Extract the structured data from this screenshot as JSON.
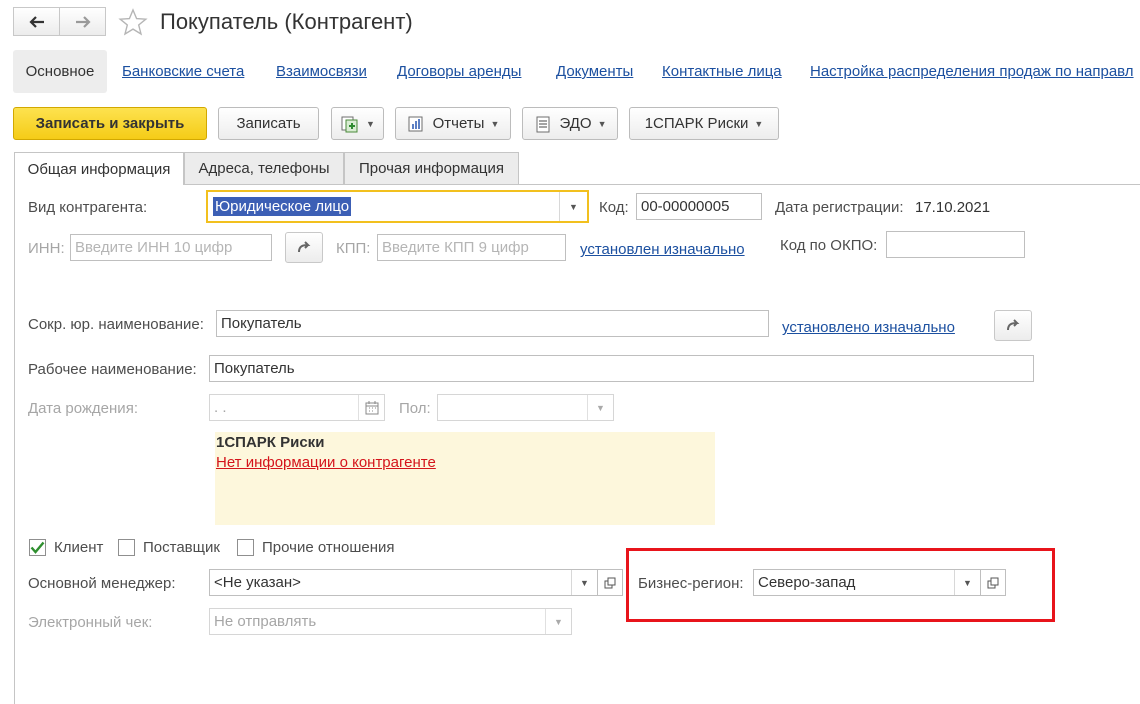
{
  "window": {
    "title": "Покупатель (Контрагент)"
  },
  "section_nav": [
    {
      "label": "Основное",
      "active": true
    },
    {
      "label": "Банковские счета"
    },
    {
      "label": "Взаимосвязи"
    },
    {
      "label": "Договоры аренды"
    },
    {
      "label": "Документы"
    },
    {
      "label": "Контактные лица"
    },
    {
      "label": "Настройка распределения продаж по направл"
    }
  ],
  "toolbar": {
    "save_close": "Записать и закрыть",
    "save": "Записать",
    "reports": "Отчеты",
    "edo": "ЭДО",
    "spark": "1СПАРК Риски"
  },
  "tabs": [
    {
      "label": "Общая информация",
      "active": true
    },
    {
      "label": "Адреса, телефоны"
    },
    {
      "label": "Прочая информация"
    }
  ],
  "form": {
    "kind_label": "Вид контрагента:",
    "kind_value": "Юридическое лицо",
    "code_label": "Код:",
    "code_value": "00-00000005",
    "reg_date_label": "Дата регистрации:",
    "reg_date_value": "17.10.2021",
    "inn_label": "ИНН:",
    "inn_placeholder": "Введите ИНН 10 цифр",
    "kpp_label": "КПП:",
    "kpp_placeholder": "Введите КПП 9 цифр",
    "kpp_link": "установлен изначально",
    "okpo_label": "Код по ОКПО:",
    "okpo_value": "",
    "short_name_label": "Сокр. юр. наименование:",
    "short_name_value": "Покупатель",
    "short_name_link": "установлено изначально",
    "work_name_label": "Рабочее наименование:",
    "work_name_value": "Покупатель",
    "birth_date_label": "Дата рождения:",
    "birth_date_value": " .  .",
    "gender_label": "Пол:",
    "gender_value": "",
    "client_label": "Клиент",
    "client_checked": true,
    "supplier_label": "Поставщик",
    "supplier_checked": false,
    "other_label": "Прочие отношения",
    "other_checked": false,
    "manager_label": "Основной менеджер:",
    "manager_value": "<Не указан>",
    "region_label": "Бизнес-регион:",
    "region_value": "Северо-запад",
    "receipt_label": "Электронный чек:",
    "receipt_value": "Не отправлять"
  },
  "spark_panel": {
    "title": "1СПАРК Риски",
    "message": "Нет информации о контрагенте"
  },
  "colors": {
    "accent_yellow": "#f5cc17",
    "link_blue": "#1c50a0",
    "highlight_red": "#e8141b",
    "spark_bg": "#fdf7dc",
    "spark_link_red": "#d4141b",
    "selection_blue": "#3c5fb5"
  }
}
